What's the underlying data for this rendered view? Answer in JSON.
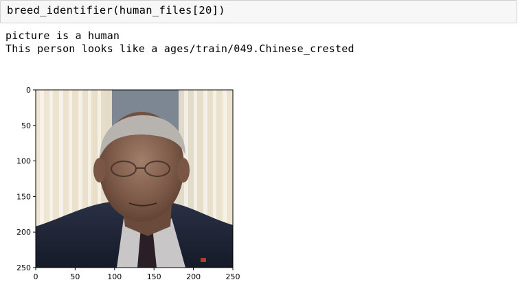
{
  "cell": {
    "code": "breed_identifier(human_files[20])"
  },
  "output": {
    "lines": [
      "picture is a human",
      "This person looks like a ages/train/049.Chinese_crested"
    ]
  },
  "figure": {
    "x_ticks": [
      "0",
      "50",
      "100",
      "150",
      "200",
      "250"
    ],
    "y_ticks": [
      "0",
      "50",
      "100",
      "150",
      "200",
      "250"
    ]
  }
}
